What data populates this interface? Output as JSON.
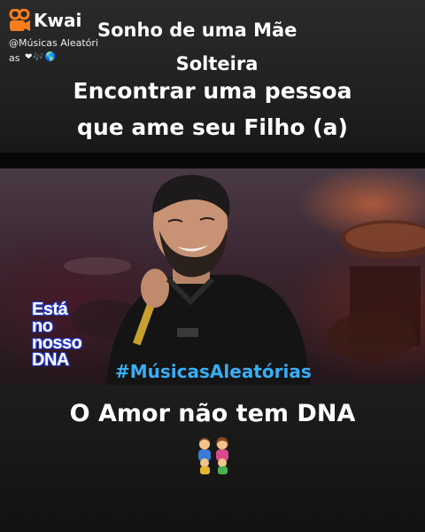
{
  "kwai": {
    "brand": "Kwai",
    "handle": "@Músicas Aleatóri",
    "handle_cont": "as",
    "handle_emojis": "❤🎶🌎",
    "logo_icon": "kwai-logo-icon",
    "accent": "#f97d1c"
  },
  "title": {
    "line1": "Sonho de uma Mãe",
    "line2": "Solteira"
  },
  "subtitle": {
    "line1": "Encontrar uma pessoa",
    "line2": "que ame seu Filho (a)"
  },
  "overlay": {
    "sticker_lines": [
      "Está",
      "no",
      "nosso",
      "DNA"
    ],
    "hashtag": "#MúsicasAleatórias",
    "hashtag_color": "#38aef5"
  },
  "caption": {
    "main": "O Amor não tem DNA",
    "emoji_icon": "family-icon"
  }
}
